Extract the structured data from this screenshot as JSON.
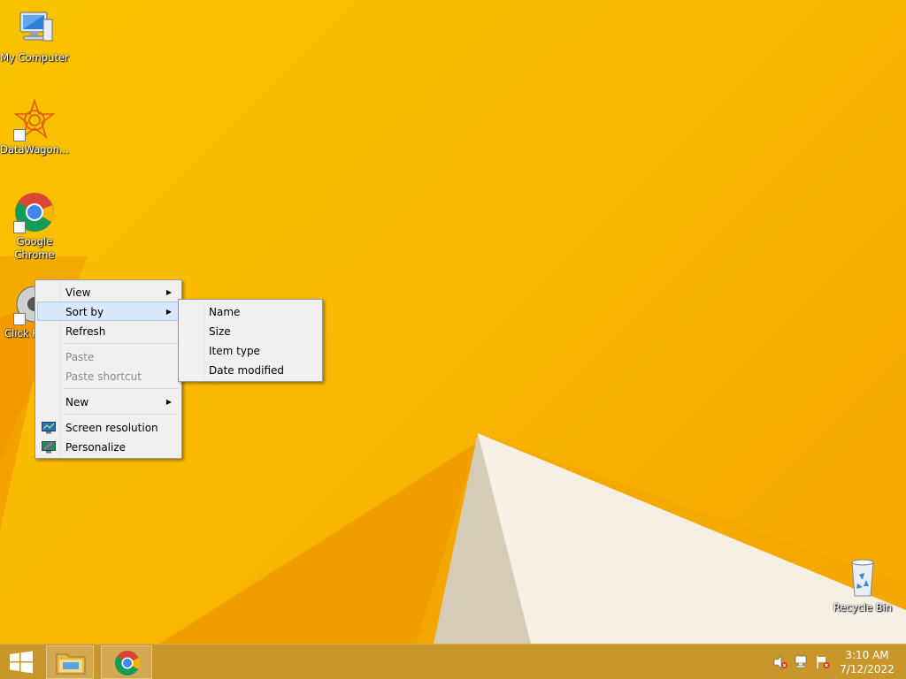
{
  "desktop": {
    "icons": [
      {
        "label": "My Computer",
        "icon": "computer-icon"
      },
      {
        "label": "DataWagon...",
        "icon": "datawagon-icon"
      },
      {
        "label": "Google Chrome",
        "icon": "chrome-icon"
      },
      {
        "label": "Click Fusion",
        "icon": "clickfusion-icon"
      },
      {
        "label": "Recycle Bin",
        "icon": "recycle-bin-icon"
      }
    ]
  },
  "context_menu": {
    "items": [
      {
        "label": "View",
        "has_submenu": true
      },
      {
        "label": "Sort by",
        "has_submenu": true,
        "highlighted": true
      },
      {
        "label": "Refresh"
      },
      {
        "label": "Paste",
        "disabled": true
      },
      {
        "label": "Paste shortcut",
        "disabled": true
      },
      {
        "label": "New",
        "has_submenu": true
      },
      {
        "label": "Screen resolution",
        "icon": "screen-resolution-icon"
      },
      {
        "label": "Personalize",
        "icon": "personalize-icon"
      }
    ],
    "arrow_glyph": "▶"
  },
  "sort_submenu": {
    "items": [
      {
        "label": "Name"
      },
      {
        "label": "Size"
      },
      {
        "label": "Item type"
      },
      {
        "label": "Date modified"
      }
    ]
  },
  "taskbar": {
    "pinned": [
      {
        "name": "file-explorer",
        "icon": "folder-icon"
      },
      {
        "name": "google-chrome",
        "icon": "chrome-icon"
      }
    ],
    "tray": {
      "icons": [
        "speaker-muted-icon",
        "network-icon",
        "action-center-flag-icon"
      ],
      "time": "3:10 AM",
      "date": "7/12/2022"
    }
  },
  "colors": {
    "wallpaper": "#f8b800",
    "taskbar": "#c8962a",
    "menu_highlight": "#d9e8fb"
  }
}
